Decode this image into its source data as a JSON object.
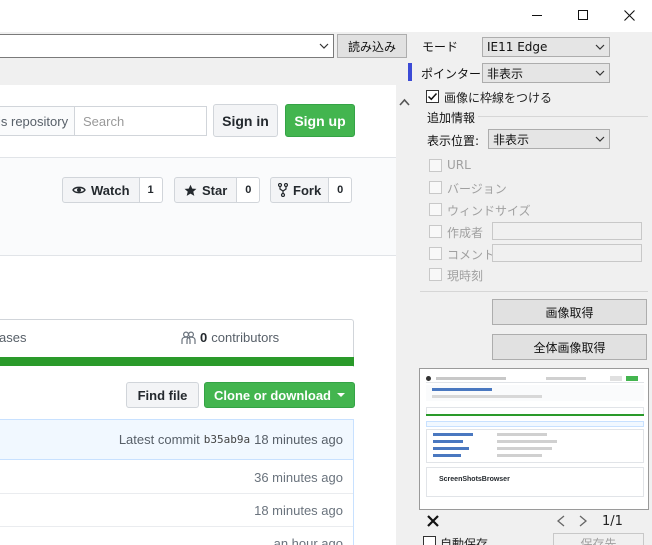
{
  "window": {
    "minimize_icon": "minimize-icon",
    "maximize_icon": "maximize-icon",
    "close_icon": "close-icon"
  },
  "address_bar": {
    "url": "",
    "load_button_label": "読み込み"
  },
  "github": {
    "search_scope_label": "is repository",
    "search_placeholder": "Search",
    "sign_in_label": "Sign in",
    "sign_up_label": "Sign up",
    "watch_label": "Watch",
    "watch_count": "1",
    "star_label": "Star",
    "star_count": "0",
    "fork_label": "Fork",
    "fork_count": "0",
    "releases_label": "ases",
    "contributors_count": "0",
    "contributors_label": "contributors",
    "find_file_label": "Find file",
    "clone_label": "Clone or download",
    "latest_commit_label": "Latest commit",
    "latest_commit_sha": "b35ab9a",
    "latest_commit_age": "18 minutes ago",
    "file_rows": [
      {
        "age": "36 minutes ago"
      },
      {
        "age": "18 minutes ago"
      },
      {
        "age": "an hour ago"
      }
    ]
  },
  "panel": {
    "mode_label": "モード",
    "mode_value": "IE11 Edge",
    "pointer_label": "ポインター",
    "pointer_value": "非表示",
    "frame_checkbox_label": "画像に枠線をつける",
    "frame_checked": true,
    "extra_info_label": "追加情報",
    "position_label": "表示位置:",
    "position_value": "非表示",
    "options": [
      {
        "label": "URL",
        "checked": false
      },
      {
        "label": "バージョン",
        "checked": false
      },
      {
        "label": "ウィンドサイズ",
        "checked": false
      },
      {
        "label": "作成者",
        "checked": false
      },
      {
        "label": "コメント",
        "checked": false
      },
      {
        "label": "現時刻",
        "checked": false
      }
    ],
    "capture_button_label": "画像取得",
    "full_capture_button_label": "全体画像取得",
    "preview_caption": "ScreenShotsBrowser",
    "page_indicator": "1/1",
    "autosave_label": "自動保存",
    "save_button_label": "保存先"
  },
  "colors": {
    "github_green": "#43b54f",
    "progress_green": "#2a9a2a",
    "pointer_marker": "#3c4bd6",
    "commit_bg": "#f1f8ff"
  }
}
